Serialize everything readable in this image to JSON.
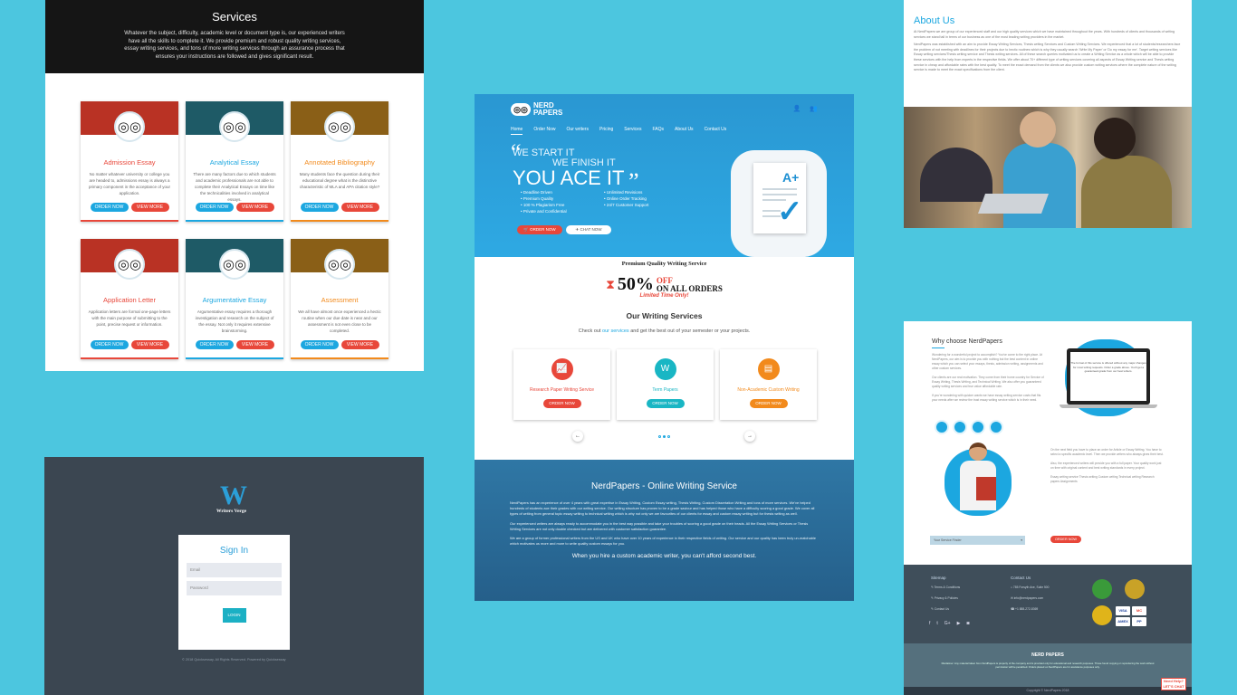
{
  "services": {
    "title": "Services",
    "intro": "Whatever the subject, difficulty, academic level or document type is, our experienced writers have all the skills to complete it. We provide premium and robust quality writing services, essay writing services, and tons of more writing services through an assurance process that ensures your instructions are followed and gives significant result.",
    "cards": [
      {
        "title": "Admission Essay",
        "title_color": "#e8473a",
        "banner": "#b93224",
        "line": "#e8473a",
        "text": "No matter whatever university or college you are headed to, admissions essay is always a primary component in the acceptance of your application.",
        "btn1": "ORDER NOW",
        "btn2": "VIEW MORE"
      },
      {
        "title": "Analytical Essay",
        "title_color": "#1ca7e0",
        "banner": "#1e5a66",
        "line": "#1ca7e0",
        "text": "There are many factors due to which students and academic professionals are not able to complete their Analytical Essays on time like the technicalities involved in analytical essays.",
        "btn1": "ORDER NOW",
        "btn2": "VIEW MORE"
      },
      {
        "title": "Annotated Bibliography",
        "title_color": "#f28a1c",
        "banner": "#8a5f17",
        "line": "#f28a1c",
        "text": "Many students face the question during their educational degree what is the distinctive characteristic of MLA and APA citation style?",
        "btn1": "ORDER NOW",
        "btn2": "VIEW MORE"
      },
      {
        "title": "Application Letter",
        "title_color": "#e8473a",
        "banner": "#b93224",
        "line": "#e8473a",
        "text": "Application letters are formal one-page letters with the main purpose of submitting to the point, precise request or information.",
        "btn1": "ORDER NOW",
        "btn2": "VIEW MORE"
      },
      {
        "title": "Argumentative Essay",
        "title_color": "#1ca7e0",
        "banner": "#1e5a66",
        "line": "#1ca7e0",
        "text": "Argumentative essay requires a thorough investigation and research on the subject of the essay. Not only it requires extensive brainstorming.",
        "btn1": "ORDER NOW",
        "btn2": "VIEW MORE"
      },
      {
        "title": "Assessment",
        "title_color": "#f28a1c",
        "banner": "#8a5f17",
        "line": "#f28a1c",
        "text": "We all have almost once experienced a hectic routine when our due date is near and our assessment is not even close to be completed.",
        "btn1": "ORDER NOW",
        "btn2": "VIEW MORE"
      }
    ]
  },
  "nerd": {
    "logo_line1": "NERD",
    "logo_line2": "PAPERS",
    "nav": [
      "Home",
      "Order Now",
      "Our writers",
      "Pricing",
      "Services",
      "FAQs",
      "About Us",
      "Contact Us"
    ],
    "hero": {
      "l1": "WE START IT",
      "l2": "WE FINISH IT",
      "l3": "YOU ACE IT"
    },
    "features": [
      "Deadline Driven",
      "Unlimited Revisions",
      "Premium Quality",
      "Online Order Tracking",
      "100 % Plagiarism Free",
      "24/7 Customer Support",
      "Private and Confidential"
    ],
    "order_btn": "ORDER NOW",
    "chat_btn": "CHAT NOW",
    "grade": "A+",
    "promo_title": "Premium Quality Writing Service",
    "promo_pct": "50%",
    "promo_off": "OFF",
    "promo_orders": "ON ALL ORDERS",
    "promo_limited": "Limited Time Only!",
    "ows_title": "Our Writing Services",
    "ows_pre": "Check out ",
    "ows_link": "our services",
    "ows_post": " and get the best out of your semester or your projects.",
    "wcards": [
      {
        "title": "Research Paper Writing Service",
        "color": "#e8473a",
        "btn": "ORDER NOW"
      },
      {
        "title": "Term Papers",
        "color": "#19b6c4",
        "btn": "ORDER NOW"
      },
      {
        "title": "Non-Academic Custom Writing",
        "color": "#f28a1c",
        "btn": "ORDER NOW"
      }
    ],
    "about_title": "NerdPapers - Online Writing Service",
    "about_p1": "NerdPapers has an experience of over 4 years with great expertise in Essay Writing, Custom Essay writing, Thesis Writing, Custom Dissertation Writing and tons of more services. We've helped hundreds of students ace their grades with our writing service. Our writing structure has proven to be a grade saviour and has helped those who have a difficulty scoring a good grade. We cover all types of writing from general topic essay writing to technical writing which is why not only we are favourites of our clients for essay and custom essay writing but for thesis writing as well.",
    "about_p2": "Our experienced writers are always ready to accommodate you in the best way possible and take your troubles of scoring a good grade on their heads. All the Essay Writing Services or Thesis Writing Services are not only double checked but are delivered with customer satisfaction guarantee.",
    "about_p3": "We are a group of former professional writers from the US and UK who have over 10 years of experience in their respective fields of writing. Our service and our quality has been truly un-matchable which motivates us more and more to write quality custom essays for you.",
    "about_end": "When you hire a custom academic writer, you can't afford second best."
  },
  "aboutus": {
    "title": "About Us",
    "p1": "At NerdPapers we are group of our experienced staff and our high quality services which we have maintained throughout the years. With hundreds of clients and thousands of writing services we stand tall in terms of our business as one of the most leading writing providers in the market.",
    "p2": "NerdPapers was established with an aim to provide Essay Writing Services, Thesis writing Services and Custom Writing Services. We experienced that a lot of students/researchers face the problem of not meeting with deadlines for their projects due to hectic routines which is why they usually search 'Write My Paper' or 'Do my essay for me'. Target writing services like Essay writing services/Thesis writing service and Thesis writing services. All of these search queries motivated us to create a Writing Service as a whole which will be able to provide these services with the help from experts in the respective fields. We offer about 70+ different type of writing services covering all aspects of Essay Writing service and Thesis writing service in cheap and affordable rates with the best quality. To meet the exact demand from the clients we also provide custom writing services where the complete nature of the writing service is made to meet the exact specifications from the client."
  },
  "why": {
    "title": "Why choose NerdPapers",
    "p1": "Wondering for a wonderful project to accomplish? You've come to the right place. At NerdPapers, our aim is to provide you with nothing but the best content in online essay which you can select your essays, thesis, admission writing, assignments and other custom services.",
    "p2": "Our clients are our real motivation. They come from their home country for Service of Essay Writing, Thesis Writing, and Technical Writing. We also offer you guaranteed quality writing services and true value affordable rate.",
    "p3": "If you're wondering with quicker wants we have essay writing service costs that fits your needs after we review the trust essay writing service which is in their need.",
    "monitor": "The format of this service is offered without any major changes for most writing requests. Order a grade above. You'll get a guaranteed grade from our best writers.",
    "p4": "On the next field you have to place an order for Article or Essay Writing. You have to select a specific academic level. Then we provide writers who always gives their best.",
    "p5": "Also, the experienced writers will provide you with a full paper. Your quality work just on time with original content and best writing standards in every project.",
    "p6": "Essay writing service Thesis writing Custom writing Technical writing Research papers Assignments",
    "select": "Your Service Finder",
    "order_btn": "ORDER NOW",
    "sitemap": "Sitemap",
    "sitemap_items": [
      "Terms & Conditions",
      "Privacy & Policies",
      "Contact Us"
    ],
    "contact": "Contact Us",
    "contact_items": [
      "785 Forsyth Ave, Suite 500",
      "info@nerdpapers.com",
      "+1 888-272-8369"
    ],
    "seal1": "#3a9a3a",
    "seal2": "#c9a227",
    "seal3": "#e0b41a",
    "cards": [
      "VISA",
      "MC",
      "AMEX",
      "PP"
    ],
    "foot_logo": "NERD PAPERS",
    "disclaimer": "Disclaimer: Any material taken from NerdPapers is property of the company and is provided only for educational and research purposes. Those found copying or reproducing the work without permission will be penalized. Orders placed on NerdPapers are for assistance purposes only.",
    "copyright": "Copyright © NerdPapers 2018",
    "chat": "Need Help? LET'S CHAT"
  },
  "login": {
    "logo_letter": "W",
    "brand": "Writers Verge",
    "title": "Sign In",
    "email_ph": "Email",
    "password_ph": "Password",
    "btn": "LOGIN",
    "copy": "© 2018 Quicksessay. All Rights Reserved. Powered by Quicksessay"
  }
}
